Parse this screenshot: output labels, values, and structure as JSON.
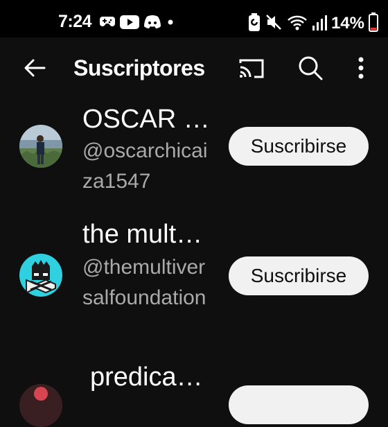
{
  "status_bar": {
    "time": "7:24",
    "battery_percent": "14%",
    "notification_icons": [
      "game-controller-icon",
      "youtube-icon",
      "discord-icon",
      "dot-icon"
    ],
    "system_icons": [
      "battery-saver-icon",
      "mute-icon",
      "wifi-icon",
      "signal-icon",
      "battery-icon"
    ]
  },
  "app_bar": {
    "title": "Suscriptores"
  },
  "subscribers": [
    {
      "name": "OSCAR …",
      "handle": "@oscarchicaiza1547",
      "button_label": "Suscribirse"
    },
    {
      "name": "the mult…",
      "handle": "@themultiversalfoundation",
      "button_label": "Suscribirse"
    },
    {
      "name": "predica…",
      "handle": "",
      "button_label": ""
    }
  ],
  "colors": {
    "background": "#0f0f0f",
    "status_bar": "#000000",
    "text_primary": "#ffffff",
    "text_secondary": "#aaaaaa",
    "button_bg": "#f1f1f1",
    "button_text": "#0f0f0f",
    "battery_low": "#e53935"
  }
}
